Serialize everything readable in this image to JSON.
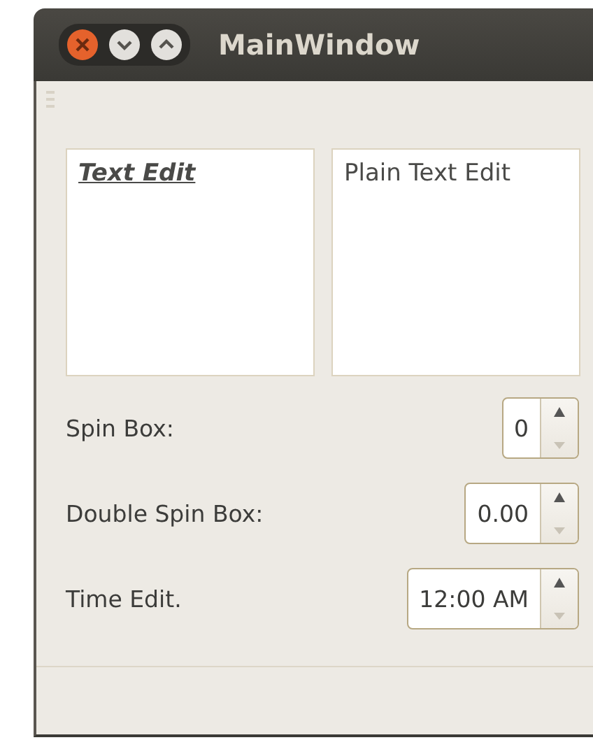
{
  "window": {
    "title": "MainWindow"
  },
  "text_edits": [
    {
      "kind": "rich",
      "text": "Text Edit"
    },
    {
      "kind": "plain",
      "text": "Plain Text Edit"
    }
  ],
  "fields": [
    {
      "label": "Spin Box:",
      "value": "0"
    },
    {
      "label": "Double Spin Box:",
      "value": "0.00"
    },
    {
      "label": "Time Edit.",
      "value": "12:00 AM"
    }
  ]
}
